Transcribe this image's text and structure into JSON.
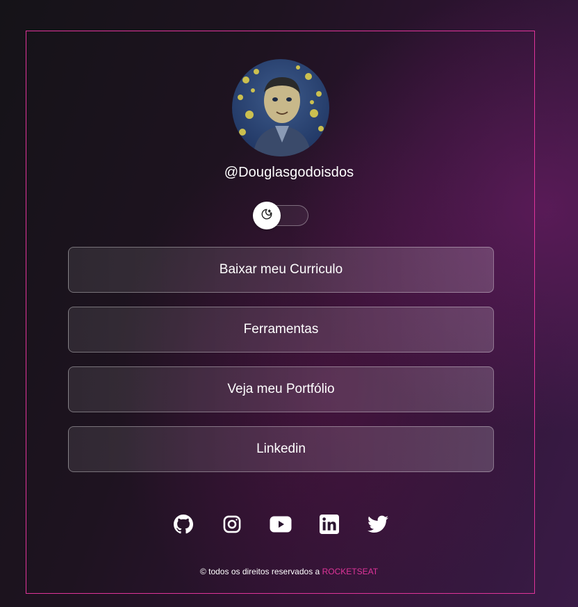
{
  "profile": {
    "username": "@Douglasgodoisdos",
    "avatar_alt": "profile photo"
  },
  "theme_toggle": {
    "icon": "moon-stars-icon",
    "state": "dark"
  },
  "links": [
    {
      "label": "Baixar meu Curriculo"
    },
    {
      "label": "Ferramentas"
    },
    {
      "label": "Veja meu Portfólio"
    },
    {
      "label": "Linkedin"
    }
  ],
  "social": [
    {
      "name": "github-icon"
    },
    {
      "name": "instagram-icon"
    },
    {
      "name": "youtube-icon"
    },
    {
      "name": "linkedin-icon"
    },
    {
      "name": "twitter-icon"
    }
  ],
  "footer": {
    "prefix": "© todos os direitos reservados a",
    "brand": "ROCKETSEAT"
  },
  "colors": {
    "accent": "#e0349a",
    "text": "#ffffff"
  }
}
